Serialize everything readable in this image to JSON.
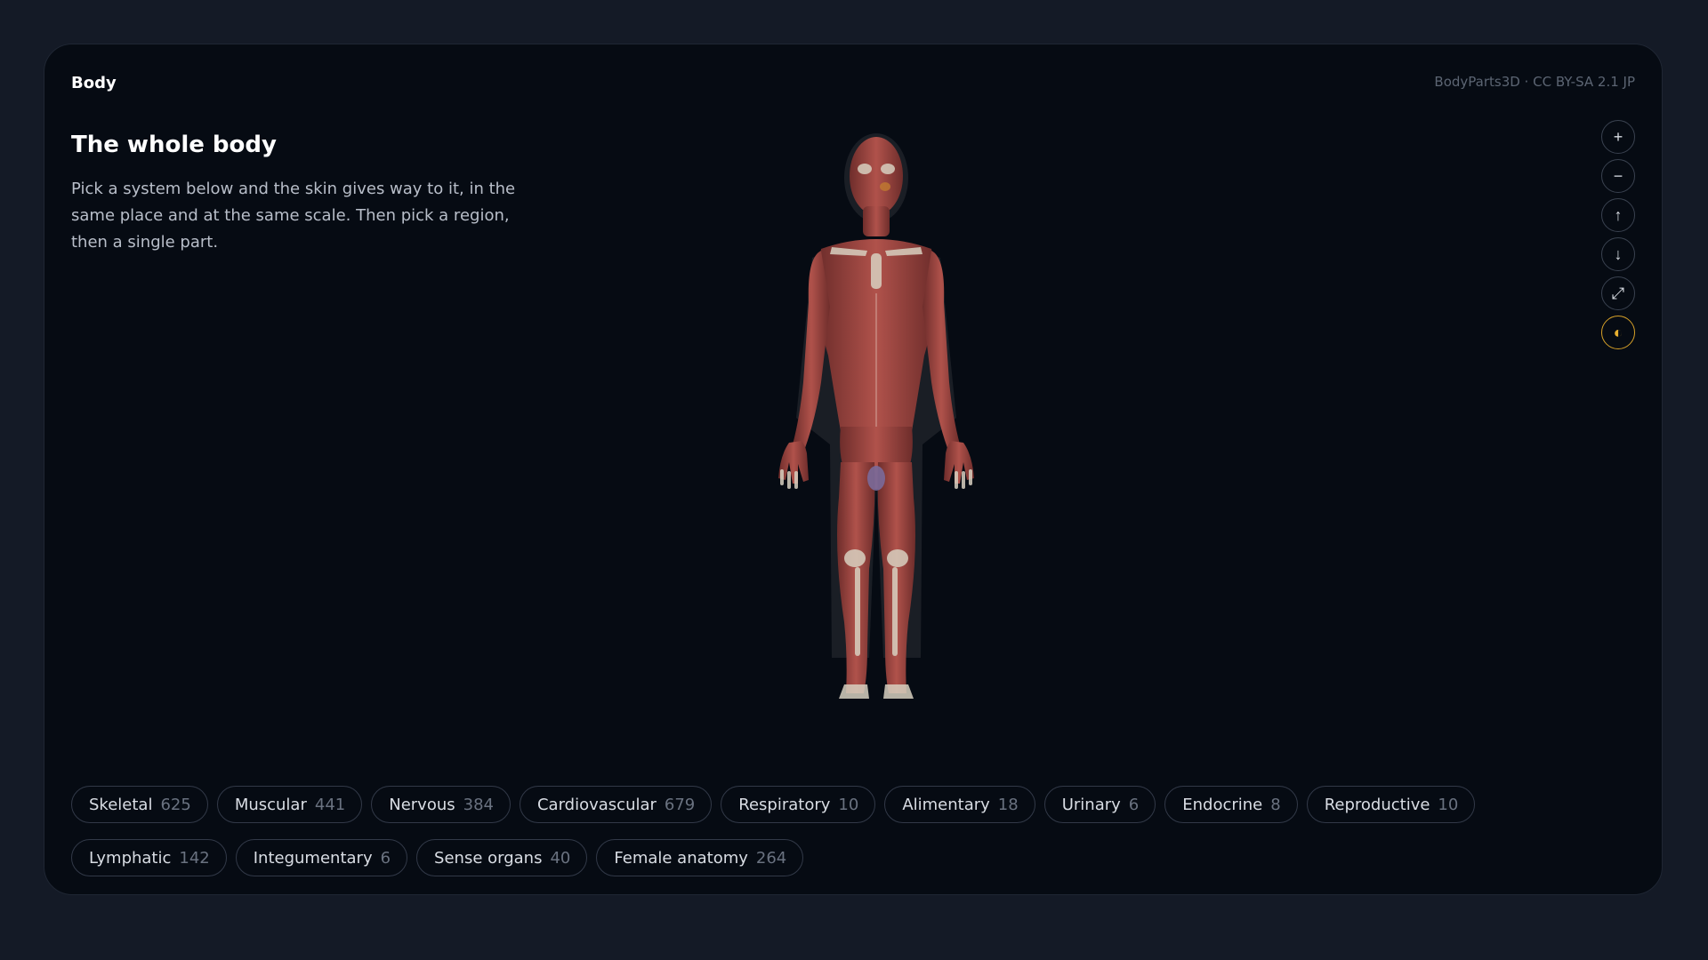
{
  "breadcrumb": "Body",
  "credit": "BodyParts3D · CC BY-SA 2.1 JP",
  "heading": {
    "title": "The whole body",
    "description": "Pick a system below and the skin gives way to it, in the same place and at the same scale. Then pick a region, then a single part."
  },
  "controls": [
    {
      "name": "zoom-in",
      "icon": "+"
    },
    {
      "name": "zoom-out",
      "icon": "−"
    },
    {
      "name": "move-up",
      "icon": "↑"
    },
    {
      "name": "move-down",
      "icon": "↓"
    },
    {
      "name": "expand",
      "icon": "⤢"
    },
    {
      "name": "contrast",
      "icon": "◐"
    }
  ],
  "systems": [
    {
      "name": "Skeletal",
      "count": "625"
    },
    {
      "name": "Muscular",
      "count": "441"
    },
    {
      "name": "Nervous",
      "count": "384"
    },
    {
      "name": "Cardiovascular",
      "count": "679"
    },
    {
      "name": "Respiratory",
      "count": "10"
    },
    {
      "name": "Alimentary",
      "count": "18"
    },
    {
      "name": "Urinary",
      "count": "6"
    },
    {
      "name": "Endocrine",
      "count": "8"
    },
    {
      "name": "Reproductive",
      "count": "10"
    },
    {
      "name": "Lymphatic",
      "count": "142"
    },
    {
      "name": "Integumentary",
      "count": "6"
    },
    {
      "name": "Sense organs",
      "count": "40"
    },
    {
      "name": "Female anatomy",
      "count": "264"
    }
  ],
  "colors": {
    "background": "#141a26",
    "panel": "#060b13",
    "muscle": "#a04843",
    "accent": "#d6a028"
  }
}
